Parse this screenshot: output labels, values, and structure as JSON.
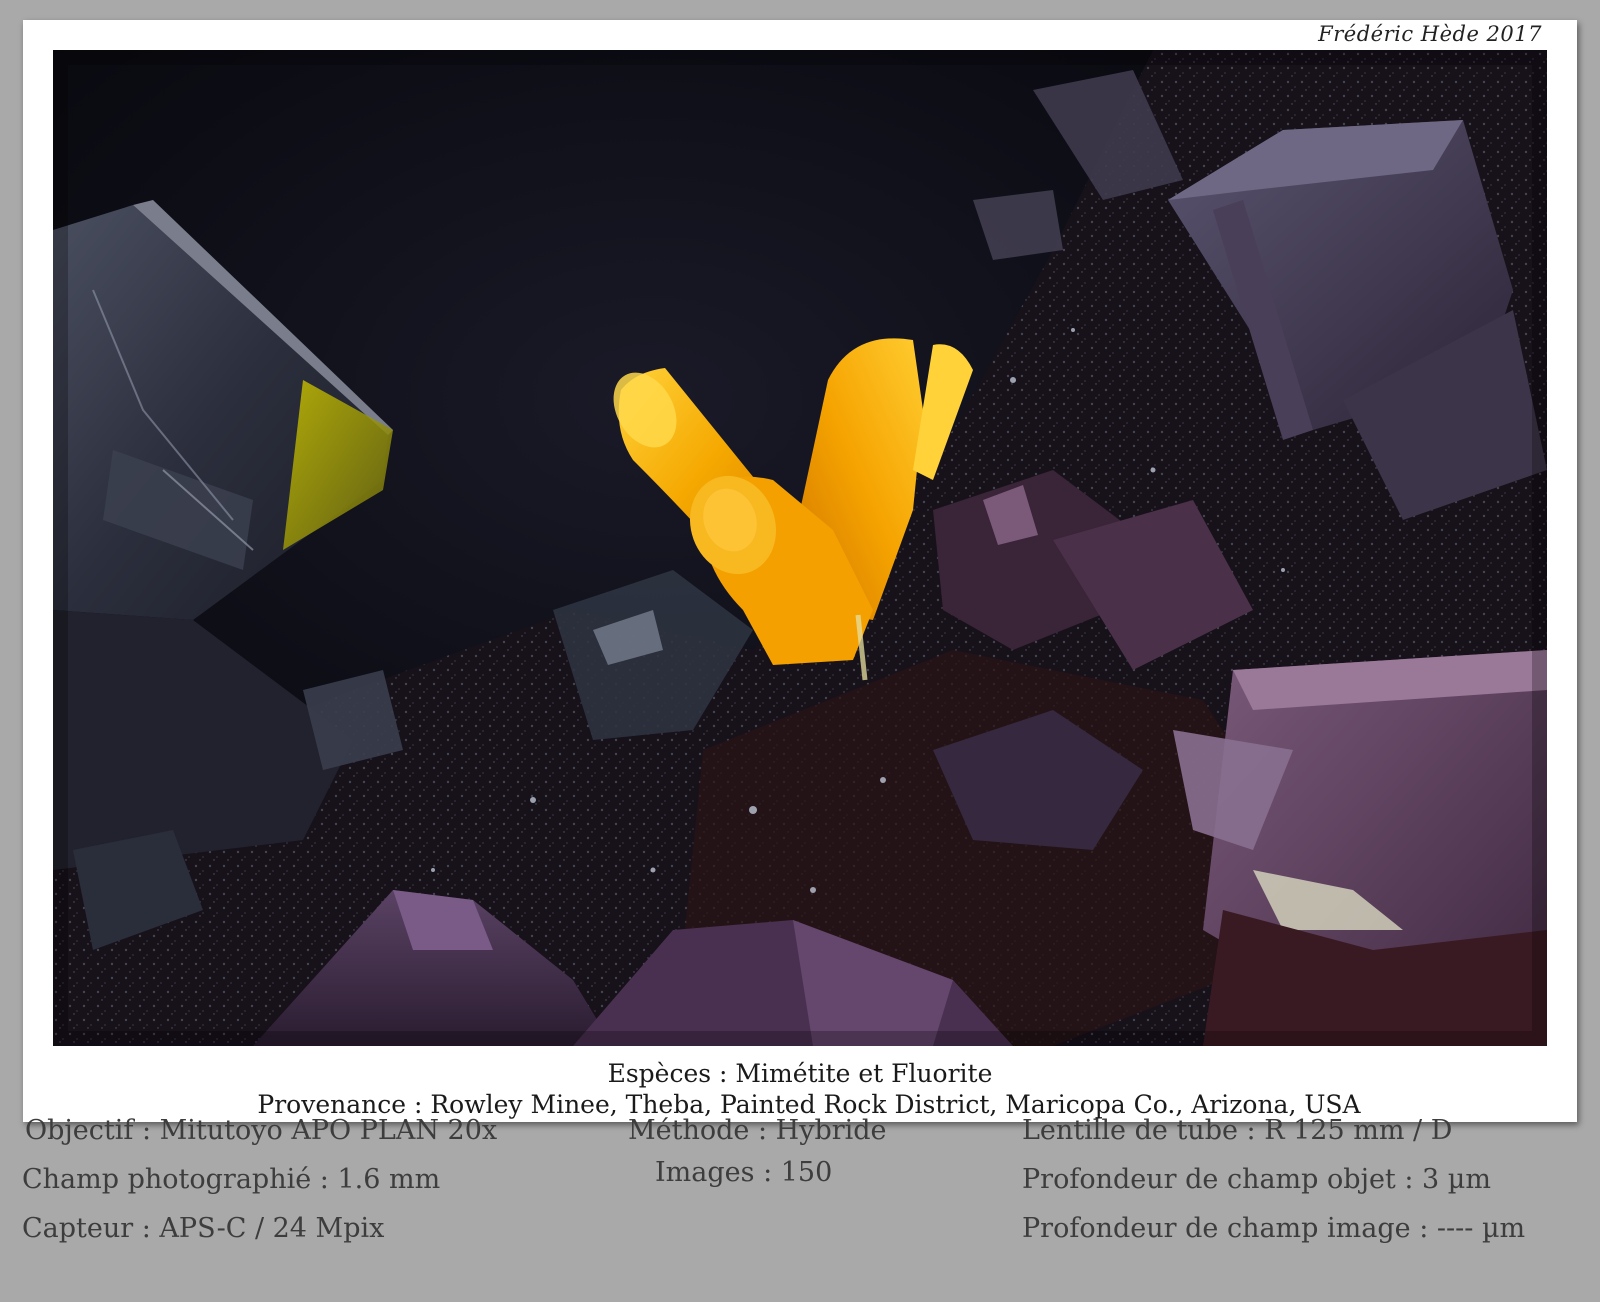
{
  "credit": "Frédéric Hède 2017",
  "photo": {
    "subject": "Mimétite crystals on fluorite",
    "colors": {
      "background": "#0b0b12",
      "mimetite": "#f5a300",
      "fluorite": "#3a2f4a",
      "matrix": "#1a1214"
    }
  },
  "caption": {
    "species": "Espèces : Mimétite et Fluorite",
    "provenance": "Provenance : Rowley Minee, Theba, Painted Rock District, Maricopa Co., Arizona, USA"
  },
  "specs": {
    "left": [
      "Objectif : Mitutoyo APO PLAN 20x",
      "Champ photographié : 1.6 mm",
      "Capteur : APS-C / 24 Mpix"
    ],
    "center": [
      "Méthode : Hybride",
      "Images : 150"
    ],
    "right": [
      "Lentille de tube : R 125 mm / D",
      "Profondeur de champ objet : 3 µm",
      "Profondeur de champ image : ---- µm"
    ]
  }
}
